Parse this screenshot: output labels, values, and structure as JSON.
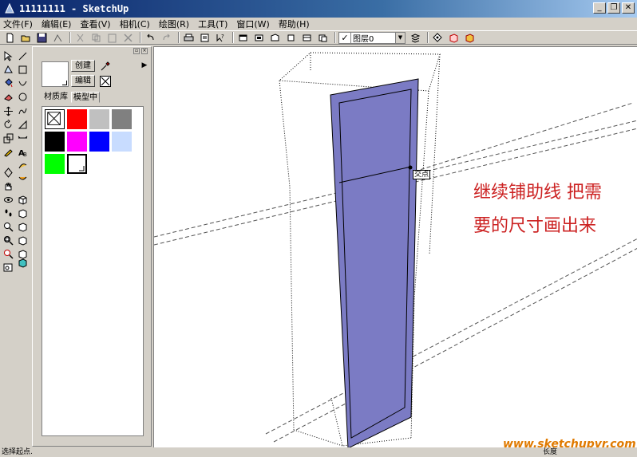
{
  "window": {
    "title": "11111111 - SketchUp",
    "minimize": "_",
    "restore": "❐",
    "close": "✕"
  },
  "menubar": {
    "items": [
      "文件(F)",
      "编辑(E)",
      "查看(V)",
      "相机(C)",
      "绘图(R)",
      "工具(T)",
      "窗口(W)",
      "帮助(H)"
    ]
  },
  "toolbar": {
    "layer_check": "✓",
    "layer_name": "图层0"
  },
  "materials_panel": {
    "create_button": "创建",
    "edit_button": "编辑",
    "tabs": [
      "材质库",
      "模型中"
    ],
    "active_tab": "模型中",
    "swatches": [
      "#ffffff",
      "#ff0000",
      "#c0c0c0",
      "#808080",
      "#000000",
      "#ff00ff",
      "#0000ff",
      "#c8dcff",
      "#00ff00",
      "#ffffff"
    ]
  },
  "viewport": {
    "tooltip": "交点",
    "annotation_line1": "继续铺助线  把需",
    "annotation_line2": "要的尺寸画出来",
    "watermark": "www.sketchupvr.com",
    "face_color": "#7b7bc4"
  },
  "statusbar": {
    "left": "选择起点.",
    "right": "长度"
  }
}
